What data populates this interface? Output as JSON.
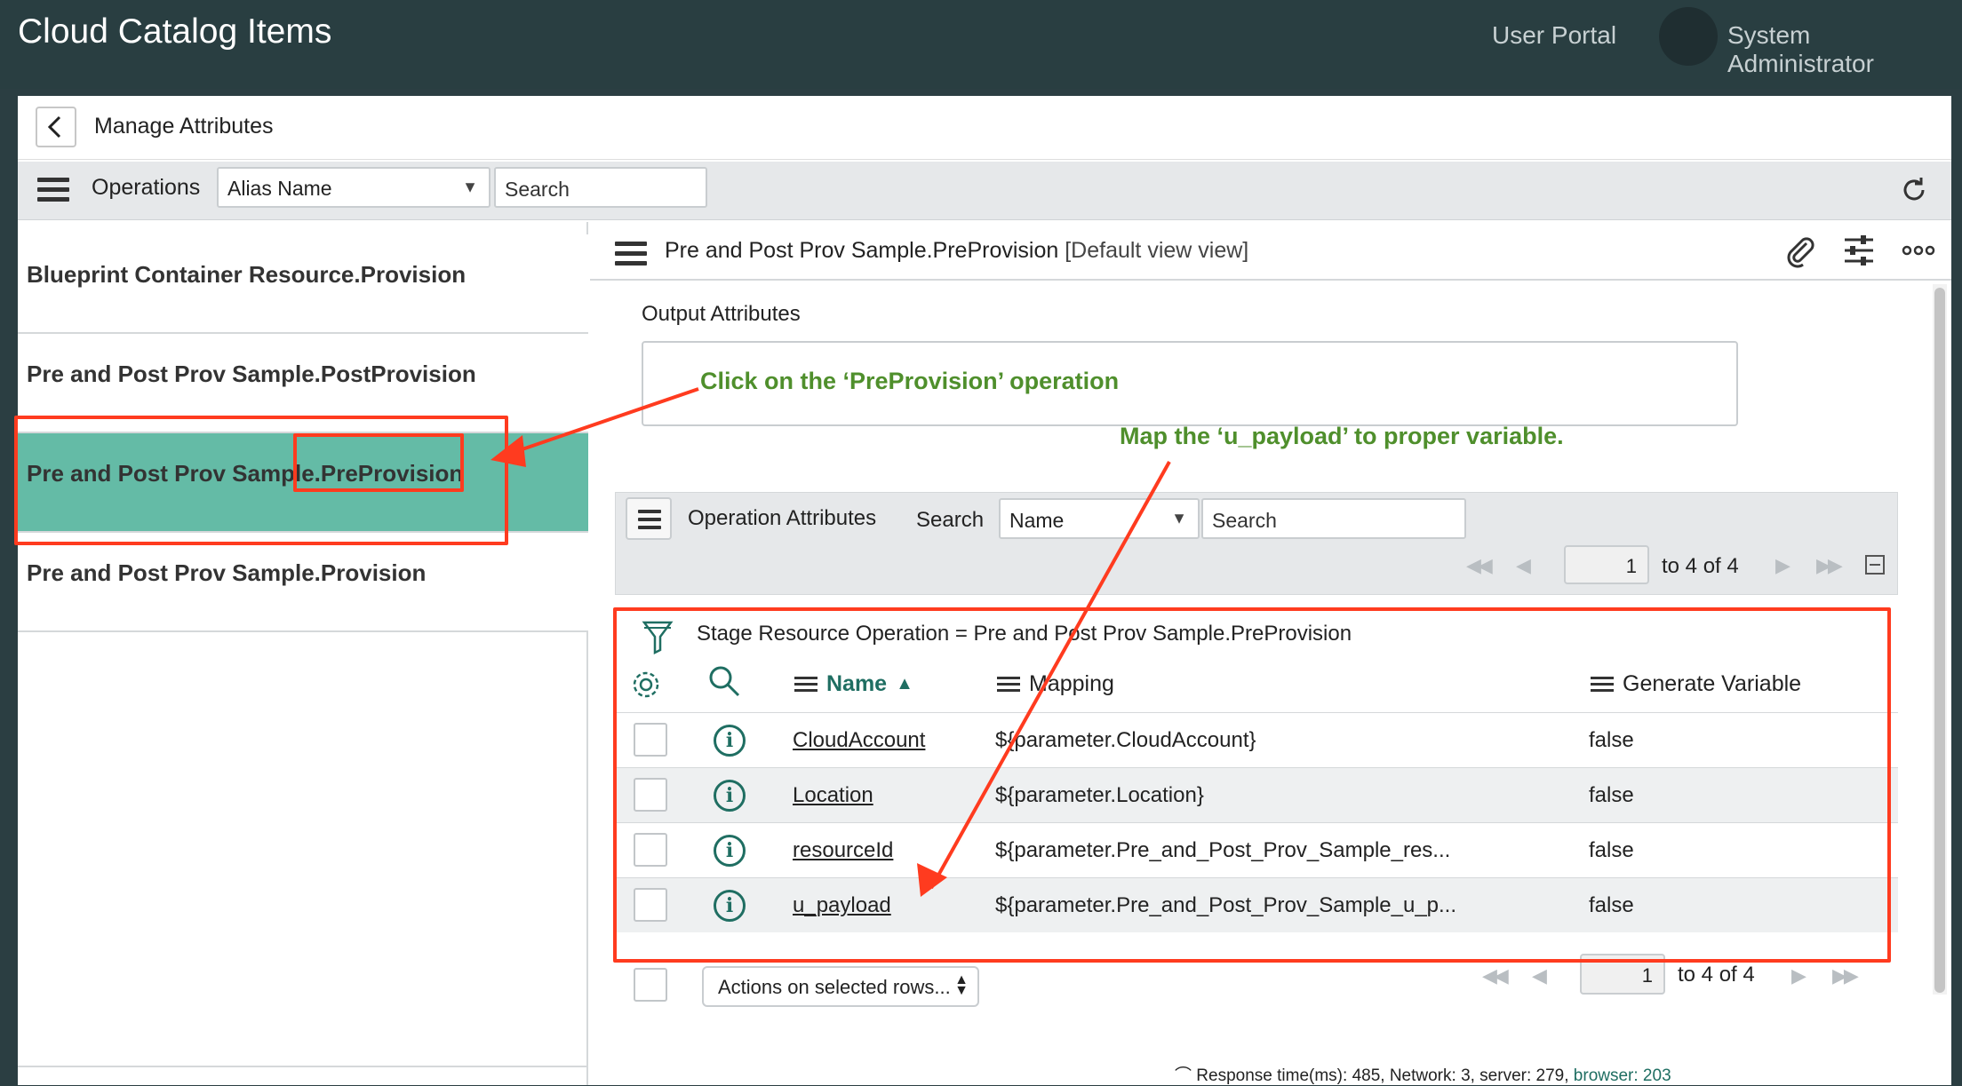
{
  "header": {
    "app_title": "Cloud Catalog Items",
    "portal_link": "User Portal",
    "user_name": "System Administrator"
  },
  "manage": {
    "title": "Manage Attributes"
  },
  "operations_bar": {
    "label": "Operations",
    "field_select": "Alias Name",
    "search_placeholder": "Search"
  },
  "operations": [
    {
      "label": "Blueprint Container Resource.Provision",
      "selected": false
    },
    {
      "label": "Pre and Post Prov Sample.PostProvision",
      "selected": false
    },
    {
      "label": "Pre and Post Prov Sample.PreProvision",
      "selected": true
    },
    {
      "label": "Pre and Post Prov Sample.Provision",
      "selected": false
    }
  ],
  "form": {
    "title": "Pre and Post Prov Sample.PreProvision",
    "view": "[Default view view]",
    "output_label": "Output Attributes"
  },
  "related_list": {
    "title": "Operation Attributes",
    "search_label": "Search",
    "field_select": "Name",
    "search_placeholder": "Search",
    "page": "1",
    "page_range": "to 4 of 4",
    "filter": "Stage Resource Operation = Pre and Post Prov Sample.PreProvision",
    "columns": {
      "name": "Name",
      "mapping": "Mapping",
      "generate": "Generate Variable"
    },
    "rows": [
      {
        "name": "CloudAccount",
        "mapping": "${parameter.CloudAccount}",
        "generate": "false"
      },
      {
        "name": "Location",
        "mapping": "${parameter.Location}",
        "generate": "false"
      },
      {
        "name": "resourceId",
        "mapping": "${parameter.Pre_and_Post_Prov_Sample_res...",
        "generate": "false"
      },
      {
        "name": "u_payload",
        "mapping": "${parameter.Pre_and_Post_Prov_Sample_u_p...",
        "generate": "false"
      }
    ],
    "actions": "Actions on selected rows...",
    "bottom_page": "1",
    "bottom_range": "to 4 of 4"
  },
  "footer": {
    "response": "Response time(ms): 485, Network: 3, server: 279,",
    "browser": "browser: 203"
  },
  "annotations": {
    "click_note": "Click on the ‘PreProvision’ operation",
    "map_note": "Map the ‘u_payload’ to proper variable.",
    "color": "#4f8f2c",
    "marker_color": "#ff3b1f"
  }
}
